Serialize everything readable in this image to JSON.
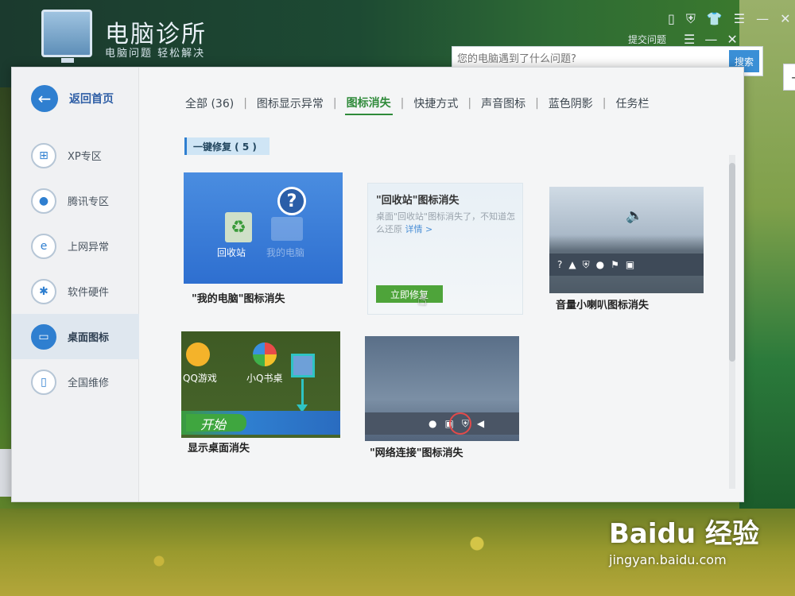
{
  "app": {
    "title": "电脑诊所",
    "subtitle": "电脑问题 轻松解决",
    "feedback": "提交问题"
  },
  "search": {
    "placeholder": "您的电脑遇到了什么问题?",
    "button": "搜索"
  },
  "sidebar": {
    "back_label": "返回首页",
    "items": [
      {
        "label": "XP专区",
        "icon": "windows-icon"
      },
      {
        "label": "腾讯专区",
        "icon": "qq-penguin-icon"
      },
      {
        "label": "上网异常",
        "icon": "ie-icon"
      },
      {
        "label": "软件硬件",
        "icon": "gear-icon"
      },
      {
        "label": "桌面图标",
        "icon": "monitor-icon",
        "active": true
      },
      {
        "label": "全国维修",
        "icon": "phone-icon"
      }
    ]
  },
  "tabs": [
    {
      "label": "全部 (36)"
    },
    {
      "label": "图标显示异常"
    },
    {
      "label": "图标消失",
      "active": true
    },
    {
      "label": "快捷方式"
    },
    {
      "label": "声音图标"
    },
    {
      "label": "蓝色阴影"
    },
    {
      "label": "任务栏"
    }
  ],
  "section": {
    "label": "一键修复 ( 5 )"
  },
  "cards": {
    "c1": {
      "caption": "\"我的电脑\"图标消失",
      "icon1": "回收站",
      "icon2": "我的电脑"
    },
    "c2": {
      "title": "\"回收站\"图标消失",
      "desc": "桌面\"回收站\"图标消失了，不知道怎么还原",
      "link": "详情 >",
      "button": "立即修复"
    },
    "c3": {
      "caption": "音量小喇叭图标消失"
    },
    "c4": {
      "caption": "显示桌面消失",
      "icon1": "QQ游戏",
      "icon2": "小Q书桌",
      "start": "开始"
    },
    "c5": {
      "caption": "\"网络连接\"图标消失"
    }
  },
  "watermark": {
    "logo": "Baidu 经验",
    "url": "jingyan.baidu.com"
  },
  "colors": {
    "accent": "#2f7fd0",
    "fix_button": "#4ea43a",
    "active_tab": "#2f8a3a"
  }
}
